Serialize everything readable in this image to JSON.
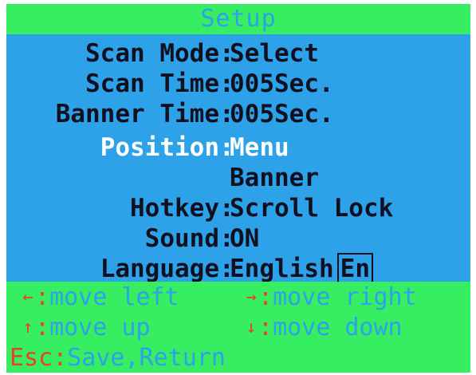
{
  "title": "Setup",
  "settings": [
    {
      "label": "Scan Mode",
      "value": "Select"
    },
    {
      "label": "Scan Time",
      "value": "005Sec."
    },
    {
      "label": "Banner Time",
      "value": "005Sec."
    },
    {
      "label": "Position",
      "value": "Menu"
    },
    {
      "label": "",
      "value": "Banner"
    },
    {
      "label": "Hotkey",
      "value": "Scroll Lock"
    },
    {
      "label": "Sound",
      "value": "ON"
    },
    {
      "label": "Language",
      "value": "English",
      "bracket": "En"
    }
  ],
  "help": {
    "left": {
      "key": "←",
      "text": "move left"
    },
    "right": {
      "key": "→",
      "text": "move right"
    },
    "up": {
      "key": "↑",
      "text": "move up"
    },
    "down": {
      "key": "↓",
      "text": "move down"
    },
    "esc": {
      "key": "Esc",
      "text": "Save,Return"
    }
  },
  "colors": {
    "panel": "#2da2e8",
    "bar": "#37ee63",
    "key": "#e8402a",
    "text": "#101020",
    "selected": "#ffffff"
  }
}
